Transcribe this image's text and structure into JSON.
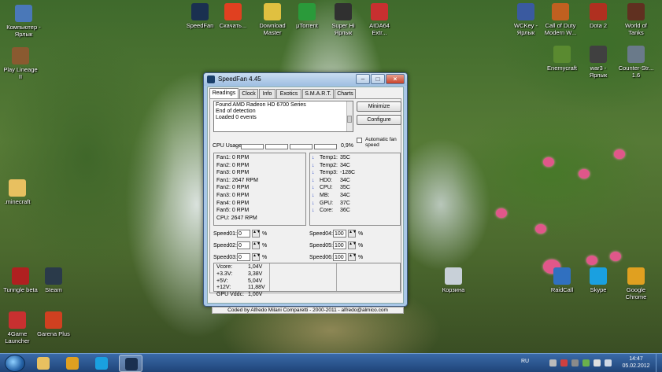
{
  "desktop": {
    "icons_left": [
      {
        "label": "Компьютер -\nЯрлык",
        "icon": "computer-icon",
        "color": "#4a78b8"
      },
      {
        "label": "Play Lineage\nII",
        "icon": "lineage-icon",
        "color": "#8a5a30"
      },
      {
        "label": ".minecraft",
        "icon": "folder-icon",
        "color": "#e8c060"
      },
      {
        "label": "Tunngle beta",
        "icon": "tunngle-icon",
        "color": "#b02020"
      },
      {
        "label": "4Game\nLauncher",
        "icon": "4game-icon",
        "color": "#c83030"
      }
    ],
    "icons_left2": [
      {
        "label": "Steam",
        "icon": "steam-icon",
        "color": "#2a3a4a"
      },
      {
        "label": "Garena Plus",
        "icon": "garena-icon",
        "color": "#d04020"
      }
    ],
    "icons_top": [
      {
        "label": "SpeedFan",
        "icon": "speedfan-icon",
        "color": "#1a3050"
      },
      {
        "label": "Скачать...",
        "icon": "browser-icon",
        "color": "#e04020"
      },
      {
        "label": "Download\nMaster",
        "icon": "download-icon",
        "color": "#e0c040"
      },
      {
        "label": "µTorrent",
        "icon": "utorrent-icon",
        "color": "#2a9a3a"
      },
      {
        "label": "Super Hi\nЯрлык",
        "icon": "video-icon",
        "color": "#303030"
      },
      {
        "label": "AIDA64\nExtr...",
        "icon": "aida-icon",
        "color": "#c83030"
      }
    ],
    "icons_right": [
      {
        "label": "WCKey -\nЯрлык",
        "icon": "wckey-icon",
        "color": "#3a5aa0"
      },
      {
        "label": "Call of Duty\nModern W...",
        "icon": "cod-icon",
        "color": "#c06020"
      },
      {
        "label": "Dota 2",
        "icon": "dota-icon",
        "color": "#b03020"
      },
      {
        "label": "World of\nTanks",
        "icon": "wot-icon",
        "color": "#603020"
      },
      {
        "label": "Enemycraft",
        "icon": "minecraft-icon",
        "color": "#5a8a30"
      },
      {
        "label": "war3 -\nЯрлык",
        "icon": "warcraft-icon",
        "color": "#404040"
      },
      {
        "label": "Counter-Str...\n1.6",
        "icon": "cs-icon",
        "color": "#6a7a8a"
      },
      {
        "label": "Корзина",
        "icon": "recycle-bin-icon",
        "color": "#c8d0d8"
      },
      {
        "label": "RaidCall",
        "icon": "raidcall-icon",
        "color": "#3070c0"
      },
      {
        "label": "Skype",
        "icon": "skype-icon",
        "color": "#1aa0e0"
      },
      {
        "label": "Google\nChrome",
        "icon": "chrome-icon",
        "color": "#e0a020"
      }
    ]
  },
  "window": {
    "title": "SpeedFan 4.45",
    "tabs": [
      "Readings",
      "Clock",
      "Info",
      "Exotics",
      "S.M.A.R.T.",
      "Charts"
    ],
    "active_tab": "Readings",
    "log_lines": [
      "Found AMD Radeon HD 6700 Series",
      "End of detection",
      "Loaded 0 events"
    ],
    "buttons": {
      "minimize": "Minimize",
      "configure": "Configure"
    },
    "auto_fan_label": "Automatic fan speed",
    "cpu_usage_label": "CPU Usage",
    "cpu_usage_value": "0,9%",
    "fans": [
      "Fan1: 0 RPM",
      "Fan2: 0 RPM",
      "Fan3: 0 RPM",
      "Fan1: 2647 RPM",
      "Fan2: 0 RPM",
      "Fan3: 0 RPM",
      "Fan4: 0 RPM",
      "Fan5: 0 RPM",
      "CPU:  2647 RPM"
    ],
    "temps": [
      {
        "name": "Temp1:",
        "value": "35C"
      },
      {
        "name": "Temp2:",
        "value": "34C"
      },
      {
        "name": "Temp3:",
        "value": "-128C"
      },
      {
        "name": "HD0:",
        "value": "34C"
      },
      {
        "name": "CPU:",
        "value": "35C"
      },
      {
        "name": "MB:",
        "value": "34C"
      },
      {
        "name": "GPU:",
        "value": "37C"
      },
      {
        "name": "Core:",
        "value": "36C"
      }
    ],
    "speeds_left": [
      {
        "label": "Speed01:",
        "value": "0"
      },
      {
        "label": "Speed02:",
        "value": "0"
      },
      {
        "label": "Speed03:",
        "value": "0"
      }
    ],
    "speeds_right": [
      {
        "label": "Speed04:",
        "value": "100"
      },
      {
        "label": "Speed05:",
        "value": "100"
      },
      {
        "label": "Speed06:",
        "value": "100"
      }
    ],
    "percent_sign": "%",
    "voltages": [
      {
        "name": "Vcore:",
        "value": "1,04V"
      },
      {
        "name": "+3.3V:",
        "value": "3,38V"
      },
      {
        "name": "+5V:",
        "value": "5,04V"
      },
      {
        "name": "+12V:",
        "value": "11,88V"
      },
      {
        "name": "GPU Vddc:",
        "value": "1,00V"
      }
    ],
    "status": "Coded by Alfredo Milani Comparetti - 2000-2011 - alfredo@almico.com"
  },
  "taskbar": {
    "pinned": [
      {
        "icon": "explorer-icon",
        "color": "#e8c060"
      },
      {
        "icon": "chrome-icon",
        "color": "#e0a020"
      },
      {
        "icon": "skype-icon",
        "color": "#1aa0e0"
      },
      {
        "icon": "speedfan-icon",
        "color": "#1a3050"
      }
    ],
    "language": "RU",
    "time": "14:47",
    "date": "05.02.2012"
  }
}
